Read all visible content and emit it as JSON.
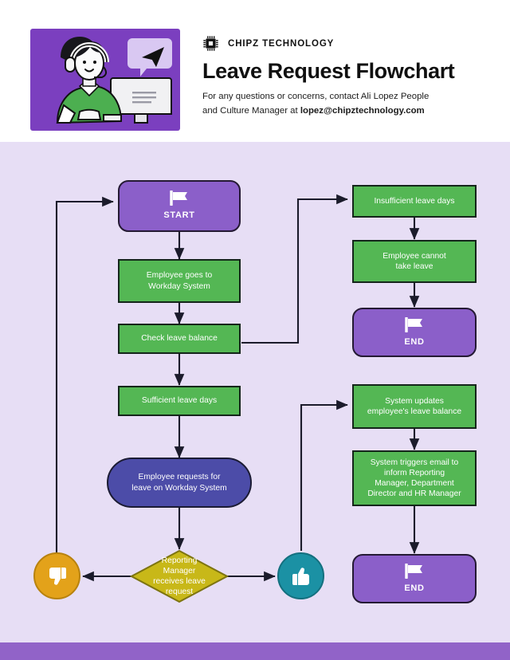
{
  "header": {
    "brand": "CHIPZ TECHNOLOGY",
    "brand_icon": "microchip-icon",
    "title": "Leave Request Flowchart",
    "subtitle_line1": "For any questions or concerns, contact Ali Lopez People",
    "subtitle_line2_prefix": "and Culture Manager at ",
    "subtitle_email": "lopez@chipztechnology.com",
    "illustration_alt": "woman-with-headset-at-computer-illustration"
  },
  "colors": {
    "purple": "#8B5FC9",
    "purple_dark": "#7B3FBF",
    "green": "#54B754",
    "blue": "#4C4CA8",
    "olive": "#C8B818",
    "orange": "#E3A21A",
    "teal": "#1B91A4",
    "canvas": "#E7DEF5",
    "footer": "#9163C8",
    "stroke": "#1b1b2b"
  },
  "chart_data": {
    "type": "diagram",
    "title": "Leave Request Flowchart",
    "nodes": [
      {
        "id": "start",
        "label": "START",
        "shape": "terminator",
        "color": "#8B5FC9",
        "icon": "flag-icon"
      },
      {
        "id": "workday",
        "label": "Employee goes to Workday System",
        "shape": "process",
        "color": "#54B754"
      },
      {
        "id": "checkbal",
        "label": "Check leave balance",
        "shape": "process",
        "color": "#54B754"
      },
      {
        "id": "sufficient",
        "label": "Sufficient leave days",
        "shape": "process",
        "color": "#54B754"
      },
      {
        "id": "request",
        "label": "Employee requests for leave on Workday System",
        "shape": "pill",
        "color": "#4C4CA8"
      },
      {
        "id": "decision",
        "label": "Reporting Manager receives leave request",
        "shape": "decision",
        "color": "#C8B818"
      },
      {
        "id": "no",
        "label": "thumbs-down",
        "shape": "circle",
        "color": "#E3A21A",
        "icon": "thumbs-down-icon"
      },
      {
        "id": "yes",
        "label": "thumbs-up",
        "shape": "circle",
        "color": "#1B91A4",
        "icon": "thumbs-up-icon"
      },
      {
        "id": "insufficient",
        "label": "Insufficient leave days",
        "shape": "process",
        "color": "#54B754"
      },
      {
        "id": "cannot",
        "label": "Employee cannot take leave",
        "shape": "process",
        "color": "#54B754"
      },
      {
        "id": "end1",
        "label": "END",
        "shape": "terminator",
        "color": "#8B5FC9",
        "icon": "flag-icon"
      },
      {
        "id": "update",
        "label": "System updates employee's leave balance",
        "shape": "process",
        "color": "#54B754"
      },
      {
        "id": "email",
        "label": "System triggers email to inform Reporting Manager, Department Director and HR Manager",
        "shape": "process",
        "color": "#54B754"
      },
      {
        "id": "end2",
        "label": "END",
        "shape": "terminator",
        "color": "#8B5FC9",
        "icon": "flag-icon"
      }
    ],
    "edges": [
      {
        "from": "start",
        "to": "workday"
      },
      {
        "from": "workday",
        "to": "checkbal"
      },
      {
        "from": "checkbal",
        "to": "sufficient"
      },
      {
        "from": "checkbal",
        "to": "insufficient"
      },
      {
        "from": "sufficient",
        "to": "request"
      },
      {
        "from": "request",
        "to": "decision"
      },
      {
        "from": "decision",
        "to": "no"
      },
      {
        "from": "decision",
        "to": "yes"
      },
      {
        "from": "no",
        "to": "start"
      },
      {
        "from": "yes",
        "to": "update"
      },
      {
        "from": "insufficient",
        "to": "cannot"
      },
      {
        "from": "cannot",
        "to": "end1"
      },
      {
        "from": "update",
        "to": "email"
      },
      {
        "from": "email",
        "to": "end2"
      }
    ]
  },
  "flow": {
    "start": {
      "label": "START"
    },
    "workday": {
      "line1": "Employee goes to",
      "line2": "Workday System"
    },
    "checkbal": {
      "label": "Check leave balance"
    },
    "sufficient": {
      "label": "Sufficient leave days"
    },
    "request": {
      "line1": "Employee requests for",
      "line2": "leave on Workday System"
    },
    "decision": {
      "line1": "Reporting",
      "line2": "Manager",
      "line3": "receives leave",
      "line4": "request"
    },
    "insufficient": {
      "label": "Insufficient leave days"
    },
    "cannot": {
      "line1": "Employee cannot",
      "line2": "take leave"
    },
    "end1": {
      "label": "END"
    },
    "update": {
      "line1": "System updates",
      "line2": "employee's leave balance"
    },
    "email": {
      "line1": "System triggers email to",
      "line2": "inform Reporting",
      "line3": "Manager, Department",
      "line4": "Director and HR Manager"
    },
    "end2": {
      "label": "END"
    }
  }
}
